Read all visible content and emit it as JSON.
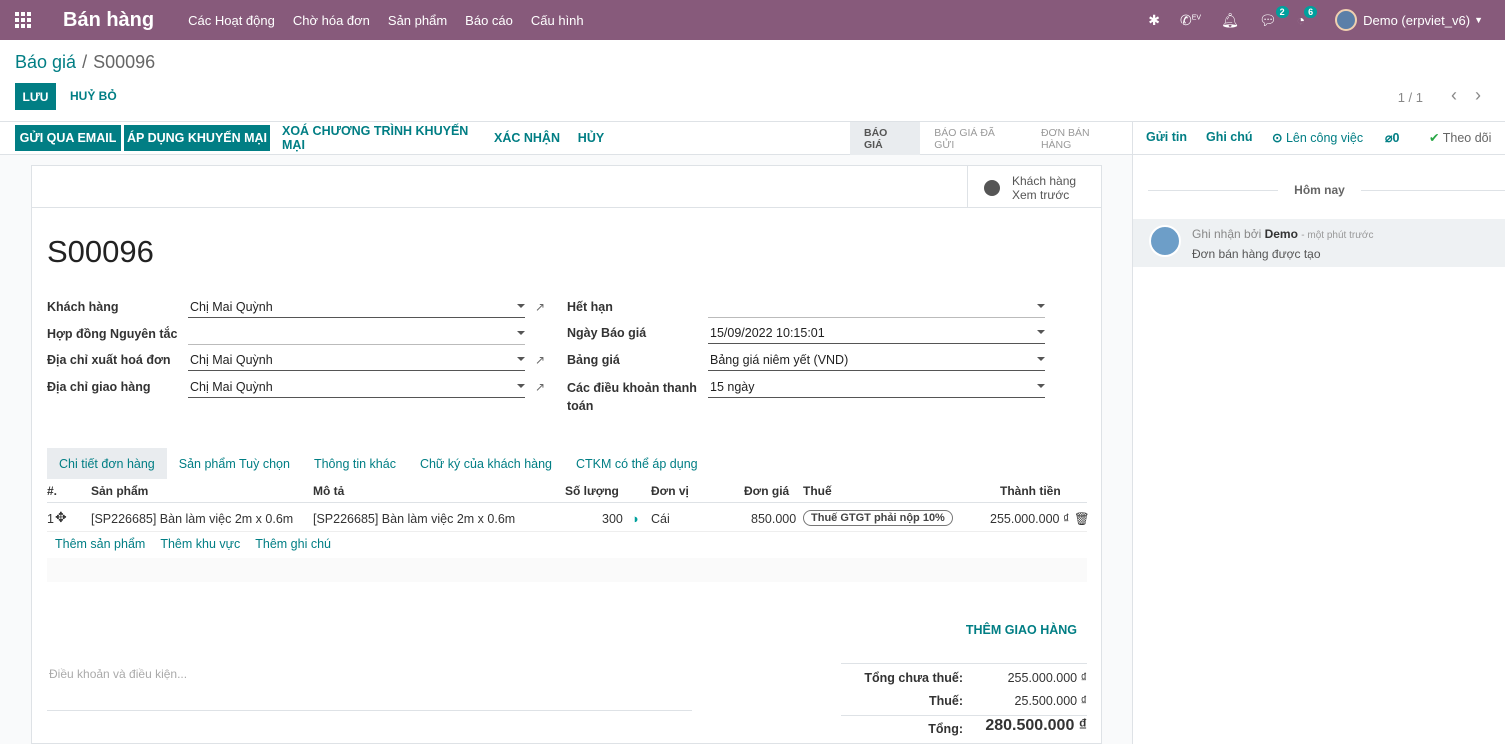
{
  "navbar": {
    "app_name": "Bán hàng",
    "menu": [
      "Các Hoạt động",
      "Chờ hóa đơn",
      "Sản phẩm",
      "Báo cáo",
      "Cấu hình"
    ],
    "chat_badge": "2",
    "activity_badge": "6",
    "user": "Demo (erpviet_v6)",
    "phone_label": "EV"
  },
  "breadcrumb": {
    "parent": "Báo giá",
    "separator": "/",
    "current": "S00096"
  },
  "actions": {
    "save": "LƯU",
    "discard": "HUỶ BỎ"
  },
  "pager": {
    "value": "1 / 1"
  },
  "statusbar": {
    "buttons": [
      "GỬI QUA EMAIL",
      "ÁP DỤNG KHUYẾN MẠI",
      "XOÁ CHƯƠNG TRÌNH KHUYẾN MẠI",
      "XÁC NHẬN",
      "HỦY"
    ],
    "stages": [
      "BÁO GIÁ",
      "BÁO GIÁ ĐÃ GỬI",
      "ĐƠN BÁN HÀNG"
    ]
  },
  "chatter": {
    "send_message": "Gửi tin",
    "log_note": "Ghi chú",
    "schedule": "Lên công việc",
    "attachments": "0",
    "follow": "Theo dõi",
    "date_divider": "Hôm nay",
    "message": {
      "prefix": "Ghi nhận bởi",
      "author": "Demo",
      "time": "- một phút trước",
      "body": "Đơn bán hàng được tạo"
    }
  },
  "preview": {
    "line1": "Khách hàng",
    "line2": "Xem trước"
  },
  "order": {
    "name": "S00096",
    "fields_left": [
      {
        "label": "Khách hàng",
        "value": "Chị Mai Quỳnh"
      },
      {
        "label": "Hợp đồng Nguyên tắc",
        "value": ""
      },
      {
        "label": "Địa chỉ xuất hoá đơn",
        "value": "Chị Mai Quỳnh"
      },
      {
        "label": "Địa chỉ giao hàng",
        "value": "Chị Mai Quỳnh"
      }
    ],
    "fields_right": [
      {
        "label": "Hết hạn",
        "value": ""
      },
      {
        "label": "Ngày Báo giá",
        "value": "15/09/2022 10:15:01"
      },
      {
        "label": "Bảng giá",
        "value": "Bảng giá niêm yết (VND)"
      },
      {
        "label": "Các điều khoản thanh toán",
        "value": "15 ngày"
      }
    ]
  },
  "tabs": [
    "Chi tiết đơn hàng",
    "Sản phẩm Tuỳ chọn",
    "Thông tin khác",
    "Chữ ký của khách hàng",
    "CTKM có thể áp dụng"
  ],
  "table": {
    "headers": [
      "#.",
      "Sản phẩm",
      "Mô tả",
      "Số lượng",
      "Đơn vị",
      "Đơn giá",
      "Thuế",
      "Thành tiền"
    ],
    "rows": [
      {
        "seq": "1",
        "product": "[SP226685] Bàn làm việc 2m x 0.6m",
        "description": "[SP226685] Bàn làm việc 2m x 0.6m",
        "qty": "300",
        "uom": "Cái",
        "price": "850.000",
        "tax": "Thuế GTGT phải nộp 10%",
        "subtotal": "255.000.000 ₫"
      }
    ],
    "add_links": [
      "Thêm sản phẩm",
      "Thêm khu vực",
      "Thêm ghi chú"
    ]
  },
  "footer": {
    "add_delivery": "THÊM GIAO HÀNG",
    "terms_placeholder": "Điều khoản và điều kiện...",
    "untaxed_label": "Tổng chưa thuế:",
    "untaxed_value": "255.000.000 ₫",
    "tax_label": "Thuế:",
    "tax_value": "25.500.000 ₫",
    "total_label": "Tổng:",
    "total_value": "280.500.000 ₫"
  },
  "colors": {
    "brand": "#875a7b",
    "accent": "#017e84"
  }
}
